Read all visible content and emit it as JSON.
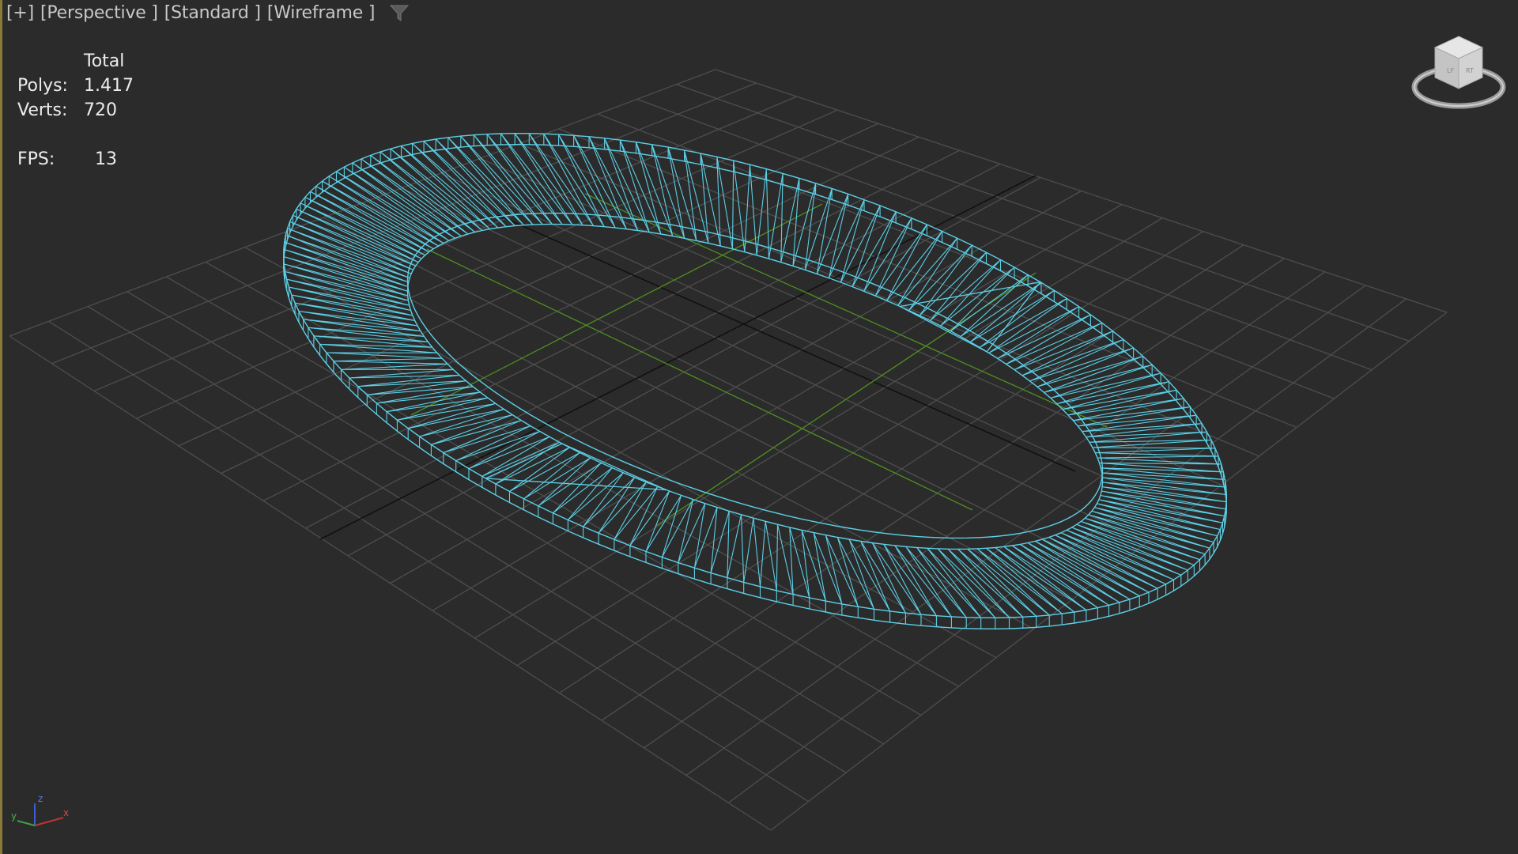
{
  "viewport": {
    "labels": [
      "[+]",
      "[Perspective ]",
      "[Standard ]",
      "[Wireframe ]"
    ],
    "filter_icon": "filter-funnel-icon"
  },
  "stats": {
    "header": "Total",
    "polys_label": "Polys:",
    "polys_value": "1.417",
    "verts_label": "Verts:",
    "verts_value": "720",
    "fps_label": "FPS:",
    "fps_value": "13"
  },
  "axis": {
    "x": "x",
    "y": "y",
    "z": "z"
  },
  "colors": {
    "background": "#2b2b2b",
    "grid": "#4e4e4e",
    "world_axis": "#111111",
    "group_axis": "#4f8f1f",
    "wireframe": "#5ccfe6",
    "text": "#ececec"
  }
}
